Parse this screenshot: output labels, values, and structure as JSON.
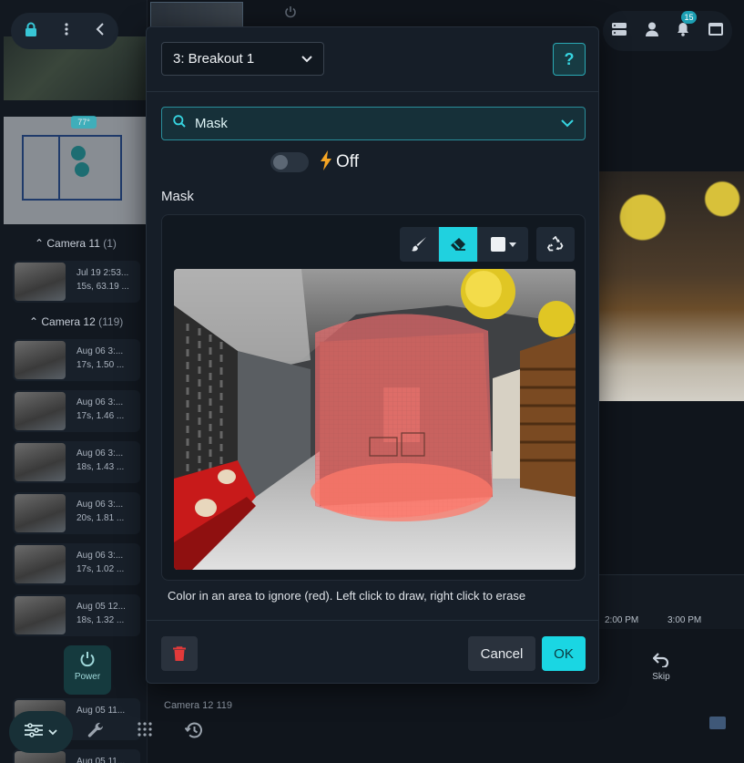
{
  "background": {
    "left_sidebar": {
      "temperature": "77°",
      "groups": [
        {
          "name": "Camera 11",
          "count": "(1)"
        },
        {
          "name": "Camera 12",
          "count": "(119)"
        }
      ],
      "clips": [
        {
          "date": "Jul 19 2:53...",
          "meta": "15s, 63.19 ..."
        },
        {
          "date": "Aug 06 3:...",
          "meta": "17s, 1.50 ..."
        },
        {
          "date": "Aug 06 3:...",
          "meta": "17s, 1.46 ..."
        },
        {
          "date": "Aug 06 3:...",
          "meta": "18s, 1.43 ..."
        },
        {
          "date": "Aug 06 3:...",
          "meta": "20s, 1.81 ..."
        },
        {
          "date": "Aug 06 3:...",
          "meta": "17s, 1.02 ..."
        },
        {
          "date": "Aug 05 12...",
          "meta": "18s, 1.32 ..."
        },
        {
          "date": "Aug 05 11...",
          "meta": ""
        },
        {
          "date": "Aug 05 11...",
          "meta": ""
        }
      ]
    },
    "notification_count": "15",
    "timeline": {
      "tick_1": "2:00 PM",
      "tick_2": "3:00 PM"
    },
    "power_label": "Power",
    "skip_label": "Skip",
    "footer_camera": "Camera 12",
    "footer_count": "119"
  },
  "modal": {
    "preset_select": "3: Breakout 1",
    "help_label": "?",
    "mode_select": "Mask",
    "toggle_label": "Off",
    "section_label": "Mask",
    "hint": "Color in an area to ignore (red). Left click to draw, right click to erase",
    "cancel_label": "Cancel",
    "ok_label": "OK"
  },
  "colors": {
    "accent": "#1ad6e3",
    "mask_red": "#ff6f6f",
    "delete_red": "#e23a3a",
    "bolt": "#f5a524"
  },
  "icons": {
    "lock": "lock-icon",
    "more": "more-vertical-icon",
    "back": "chevron-left-icon",
    "search": "search-icon",
    "brush": "brush-icon",
    "eraser": "eraser-icon",
    "recycle": "recycle-icon",
    "trash": "trash-icon",
    "bolt": "bolt-icon"
  }
}
